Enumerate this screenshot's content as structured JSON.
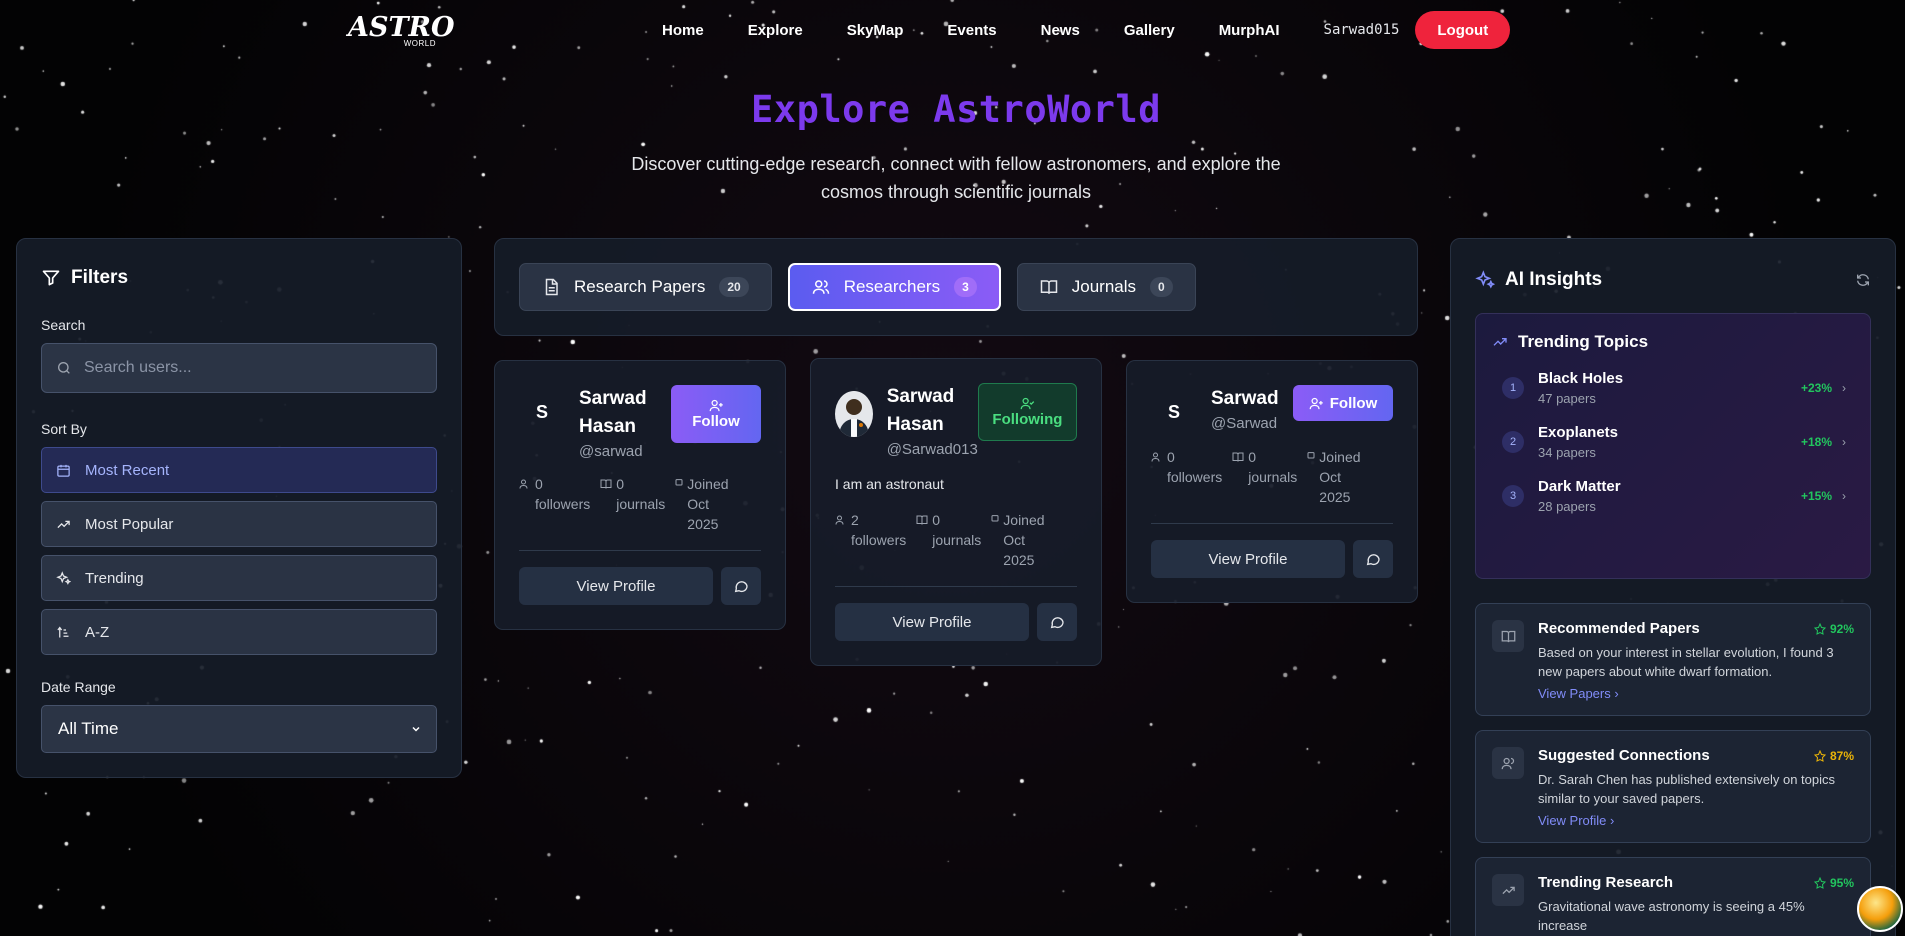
{
  "logo": {
    "main": "ASTRO",
    "sub": "WORLD"
  },
  "nav": {
    "items": [
      "Home",
      "Explore",
      "SkyMap",
      "Events",
      "News",
      "Gallery",
      "MurphAI"
    ],
    "username": "Sarwad015",
    "logout": "Logout"
  },
  "hero": {
    "title": "Explore AstroWorld",
    "subtitle": "Discover cutting-edge research, connect with fellow astronomers, and explore the cosmos through scientific journals"
  },
  "filters": {
    "title": "Filters",
    "search_label": "Search",
    "search_placeholder": "Search users...",
    "sort_label": "Sort By",
    "sort_options": [
      "Most Recent",
      "Most Popular",
      "Trending",
      "A-Z"
    ],
    "date_label": "Date Range",
    "date_value": "All Time"
  },
  "tabs": [
    {
      "label": "Research Papers",
      "count": "20",
      "icon": "document-icon"
    },
    {
      "label": "Researchers",
      "count": "3",
      "icon": "users-icon"
    },
    {
      "label": "Journals",
      "count": "0",
      "icon": "book-icon"
    }
  ],
  "cards": [
    {
      "name": "Sarwad Hasan",
      "handle": "@sarwad",
      "initial": "S",
      "bio": "",
      "followers": "0",
      "followers_label": "followers",
      "journals": "0",
      "journals_label": "journals",
      "joined": "Joined Oct 2025",
      "action": "Follow",
      "view": "View Profile"
    },
    {
      "name": "Sarwad Hasan",
      "handle": "@Sarwad013",
      "initial": "",
      "bio": "I am an astronaut",
      "followers": "2",
      "followers_label": "followers",
      "journals": "0",
      "journals_label": "journals",
      "joined": "Joined Oct 2025",
      "action": "Following",
      "view": "View Profile"
    },
    {
      "name": "Sarwad",
      "handle": "@Sarwad",
      "initial": "S",
      "bio": "",
      "followers": "0",
      "followers_label": "followers",
      "journals": "0",
      "journals_label": "journals",
      "joined": "Joined Oct 2025",
      "action": "Follow",
      "view": "View Profile"
    }
  ],
  "ai": {
    "title": "AI Insights",
    "trending_title": "Trending Topics",
    "topics": [
      {
        "rank": "1",
        "name": "Black Holes",
        "papers": "47 papers",
        "growth": "+23%"
      },
      {
        "rank": "2",
        "name": "Exoplanets",
        "papers": "34 papers",
        "growth": "+18%"
      },
      {
        "rank": "3",
        "name": "Dark Matter",
        "papers": "28 papers",
        "growth": "+15%"
      }
    ],
    "recs": [
      {
        "title": "Recommended Papers",
        "score": "92%",
        "desc": "Based on your interest in stellar evolution, I found 3 new papers about white dwarf formation.",
        "link": "View Papers ›",
        "score_color": "#22c55e"
      },
      {
        "title": "Suggested Connections",
        "score": "87%",
        "desc": "Dr. Sarah Chen has published extensively on topics similar to your saved papers.",
        "link": "View Profile ›",
        "score_color": "#eab308"
      },
      {
        "title": "Trending Research",
        "score": "95%",
        "desc": "Gravitational wave astronomy is seeing a 45% increase",
        "link": "",
        "score_color": "#22c55e"
      }
    ]
  },
  "colors": {
    "accent": "#7c3aed",
    "logout": "#ef233c",
    "positive": "#22c55e"
  }
}
